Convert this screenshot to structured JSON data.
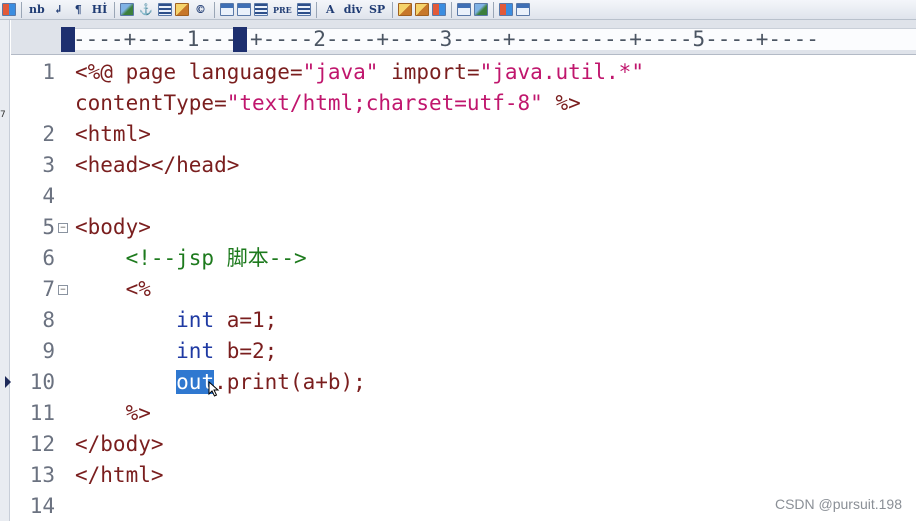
{
  "toolbar": {
    "buttons": [
      "nb",
      "¶",
      "Hİ",
      "PRE",
      "div",
      "SP"
    ]
  },
  "ruler": {
    "text": "----+----1----+----2----+----3----+---------+----5----+----"
  },
  "left_strip": {
    "mark": "7"
  },
  "editor": {
    "lines": [
      {
        "num": "1",
        "parts": [
          {
            "t": "<%@ page ",
            "c": "tag"
          },
          {
            "t": "language=",
            "c": "attr"
          },
          {
            "t": "\"java\"",
            "c": "str"
          },
          {
            "t": " import=",
            "c": "attr"
          },
          {
            "t": "\"java.util.*\"",
            "c": "str"
          }
        ]
      },
      {
        "num": "",
        "parts": [
          {
            "t": "contentType=",
            "c": "attr"
          },
          {
            "t": "\"text/html;charset=utf-8\"",
            "c": "str"
          },
          {
            "t": " %>",
            "c": "tag"
          }
        ]
      },
      {
        "num": "2",
        "parts": [
          {
            "t": "<html>",
            "c": "tag"
          }
        ]
      },
      {
        "num": "3",
        "parts": [
          {
            "t": "<head></head>",
            "c": "tag"
          }
        ]
      },
      {
        "num": "4",
        "parts": []
      },
      {
        "num": "5",
        "parts": [
          {
            "t": "<body>",
            "c": "tag"
          }
        ]
      },
      {
        "num": "6",
        "parts": [
          {
            "t": "    <!--jsp 脚本-->",
            "c": "cmt"
          }
        ]
      },
      {
        "num": "7",
        "parts": [
          {
            "t": "    <%",
            "c": "tag"
          }
        ]
      },
      {
        "num": "8",
        "parts": [
          {
            "t": "        ",
            "c": "txt"
          },
          {
            "t": "int",
            "c": "kw"
          },
          {
            "t": " a=1;",
            "c": "txt"
          }
        ]
      },
      {
        "num": "9",
        "parts": [
          {
            "t": "        ",
            "c": "txt"
          },
          {
            "t": "int",
            "c": "kw"
          },
          {
            "t": " b=2;",
            "c": "txt"
          }
        ]
      },
      {
        "num": "10",
        "parts": [
          {
            "t": "        ",
            "c": "txt"
          },
          {
            "t": "out",
            "c": "sel"
          },
          {
            "t": ".print(a+b);",
            "c": "txt"
          }
        ]
      },
      {
        "num": "11",
        "parts": [
          {
            "t": "    %>",
            "c": "tag"
          }
        ]
      },
      {
        "num": "12",
        "parts": [
          {
            "t": "</body>",
            "c": "tag"
          }
        ]
      },
      {
        "num": "13",
        "parts": [
          {
            "t": "</html>",
            "c": "tag"
          }
        ]
      },
      {
        "num": "14",
        "parts": []
      }
    ]
  },
  "watermark": "CSDN @pursuit.198",
  "colors": {
    "tag": "#7a1e1e",
    "string": "#c0166d",
    "comment": "#1d7a1d",
    "keyword": "#1f3aa3",
    "selection": "#2f78d0"
  }
}
